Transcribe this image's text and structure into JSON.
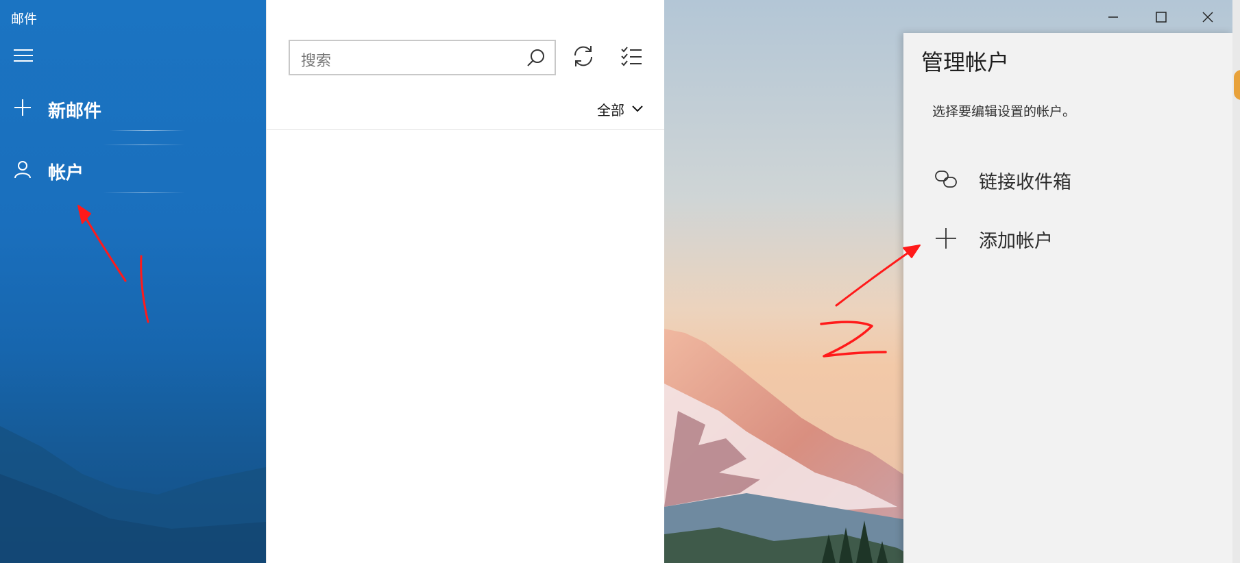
{
  "app": {
    "title": "邮件"
  },
  "nav": {
    "menu_icon": "hamburger-menu-icon",
    "items": [
      {
        "label": "新邮件",
        "icon": "plus-icon"
      },
      {
        "label": "帐户",
        "icon": "person-icon"
      }
    ]
  },
  "toolbar": {
    "search_placeholder": "搜索",
    "search_icon": "search-icon",
    "sync_icon": "sync-icon",
    "selection_mode_icon": "checklist-icon"
  },
  "filter": {
    "label": "全部",
    "icon": "chevron-down-icon"
  },
  "window_controls": {
    "minimize_icon": "minimize-icon",
    "maximize_icon": "maximize-icon",
    "close_icon": "close-icon"
  },
  "manage_accounts": {
    "title": "管理帐户",
    "subtitle": "选择要编辑设置的帐户。",
    "items": [
      {
        "label": "链接收件箱",
        "icon": "link-inboxes-icon"
      },
      {
        "label": "添加帐户",
        "icon": "plus-icon"
      }
    ]
  },
  "annotations": {
    "color": "#ff1a1a",
    "marks": [
      "1",
      "2"
    ]
  },
  "colors": {
    "nav_blue": "#1a6fbd",
    "flyout_bg": "#f2f2f2"
  }
}
